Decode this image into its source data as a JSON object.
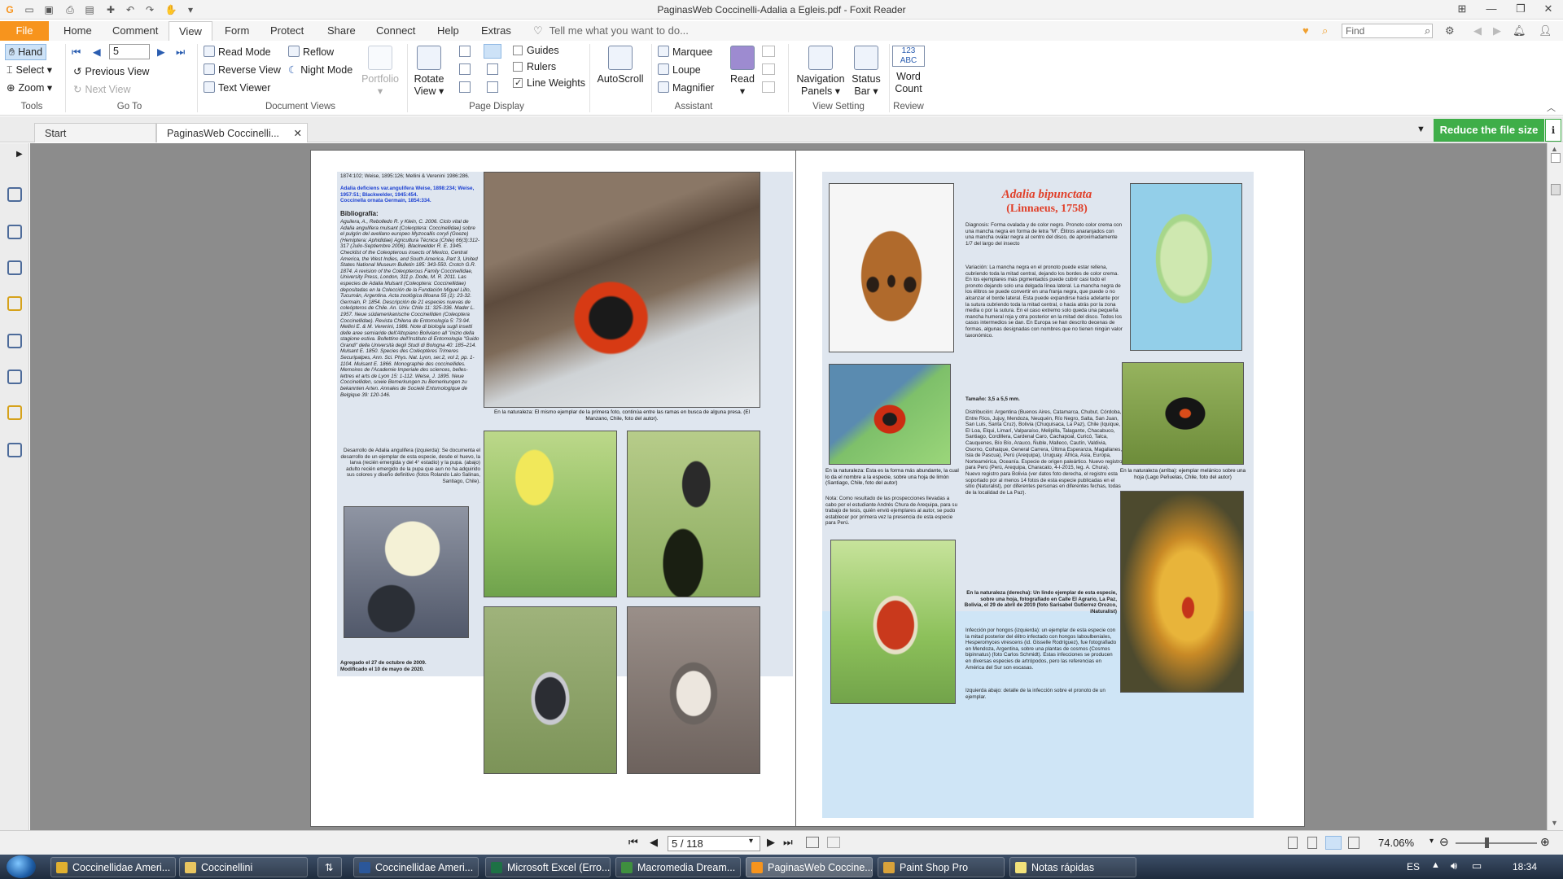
{
  "window": {
    "title": "PaginasWeb Coccinelli-Adalia a Egleis.pdf - Foxit Reader"
  },
  "ribbon_tabs": [
    "File",
    "Home",
    "Comment",
    "View",
    "Form",
    "Protect",
    "Share",
    "Connect",
    "Help",
    "Extras"
  ],
  "tell_me": "Tell me what you want to do...",
  "find_placeholder": "Find",
  "ribbon": {
    "tools": {
      "hand": "Hand",
      "select": "Select",
      "zoom": "Zoom",
      "label": "Tools"
    },
    "goto": {
      "page_value": "5",
      "previous_view": "Previous View",
      "next_view": "Next View",
      "label": "Go To"
    },
    "document_views": {
      "read_mode": "Read Mode",
      "reverse_view": "Reverse View",
      "text_viewer": "Text Viewer",
      "reflow": "Reflow",
      "night_mode": "Night Mode",
      "portfolio": "Portfolio",
      "label": "Document Views"
    },
    "page_display": {
      "rotate_view": "Rotate",
      "rotate_view2": "View",
      "guides": "Guides",
      "rulers": "Rulers",
      "line_weights": "Line Weights",
      "label": "Page Display"
    },
    "autoscroll": "AutoScroll",
    "assistant": {
      "marquee": "Marquee",
      "loupe": "Loupe",
      "magnifier": "Magnifier",
      "read": "Read",
      "label": "Assistant"
    },
    "view_setting": {
      "navigation_panels": "Navigation",
      "navigation_panels2": "Panels",
      "status_bar": "Status",
      "status_bar2": "Bar",
      "label": "View Setting"
    },
    "review": {
      "word_count_icon": "123 ABC",
      "word_count": "Word",
      "word_count2": "Count",
      "label": "Review"
    }
  },
  "doc_tabs": {
    "start": "Start",
    "active": "PaginasWeb Coccinelli..."
  },
  "reduce_button": "Reduce the file size",
  "left_page": {
    "syn_top": "1874:102; Weise, 1895:126; Mellini & Verenini 1986:286.",
    "syn1": "Adalia deficiens var.angulifera Weise, 1898:234; Weise, 1957:51; Blackwelder, 1945:454.",
    "syn2": "Coccinella ornata Germain, 1854:334.",
    "biblio_title": "Bibliografía:",
    "biblio_text": "Aguilera, A., Rebolledo R. y Klein, C. 2006. Ciclo vital de Adalia angulifera mulsant (Coleoptera: Coccinellidae) sobre el pulgón del avellano europeo Myzocallis coryli (Goeze) (Hemiptera: Aphididae) Agricultura Técnica (Chile) 66(3):312-317 (Julio-Septiembre 2006). Blackwelder R. E. 1945. Checklist of the Coleopterous insects of Mexico, Central America, the West Indies, and South America, Part 3, United States National Museum Bulletin 185: 343-550. Crotch G.R. 1874. A revision of the Coleopterous Family Coccinellidae, University Press, London, 311 p. Dode, M. R. 2011. Las especies de Adalia Mulsant (Coleoptera: Coccinellidae) depositadas en la Colección de la Fundación Miguel Lillo, Tucumán, Argentina. Acta zoológica lilloana 55 (1): 23-32. Germain, P. 1854. Descripción de 21 especies nuevas de coleópteros de Chile. An. Univ. Chile 11: 325-336. Mader L. 1957. Neue südamerikanische Coccinelliden (Coleoptera Coccinellidae). Revista Chilena de Entomología 5: 73-94. Mellini E. & M. Verenini, 1986. Note di biologia sugli insetti delle aree semiaride dell'Altopiano Boliviano all \"inizio della stagione estiva. Bollettino dell'Instituto di Entomologia \"Guido Grandi\" della Università degli Studi di Bologna 40: 185–214. Mulsant E. 1850. Species des Coléoptères Trimeres Securipalpes, Ann. Sci. Phys. Nat. Lyon, ser.2, vol 2, pp. 1-1104. Mulsant E. 1866. Monographie des coccinellides. Memoires de l'Academie Imperiale des sciences, belles-lettres et arts de Lyon 15: 1-112. Weise, J. 1895. Neue Coccinelliden, sowie Bemerkungen zu Bemerkungen zu bekannten Arten. Annales de Societé Entomologique de Belgique 39: 120-146.",
    "development": "Desarrollo de Adalia angulifera (izquierda): Se documenta el desarrollo de un ejemplar de esta especie, desde el huevo, la larva (recién emergida y del 4° estadio) y la pupa. (abajo) adulto recién emergido de la pupa que aun no ha adquirido sus colores y diseño definitivo (fotos Rolando Lalo Salinas, Santiago, Chile).",
    "main_caption": "En la naturaleza: El mismo ejemplar de la primera foto, continúa entre las ramas en busca de alguna presa. (El Manzano, Chile, foto del autor).",
    "added": "Agregado el 27 de octubre de 2009.",
    "modified": "Modificado el 10 de mayo de 2020."
  },
  "right_page": {
    "species": "Adalia bipunctata",
    "author": "(Linnaeus, 1758)",
    "diagnosis": "Diagnosis: Forma ovalada y de color negro. Pronoto color crema con una mancha negra en forma de letra \"M\". Élitros anaranjados con una mancha ovalar negra al centro del disco, de aproximadamente 1/7 del largo del insecto",
    "variation": "Variación: La mancha negra en el pronoto puede estar rellena, cubriendo toda la mitad central, dejando los bordes de color crema. En los ejemplares más pigmentados puede cubrir casi todo el pronoto dejando solo una delgada línea lateral. La mancha negra de los élitros se puede convertir en una franja negra, que puede o no alcanzar el borde lateral. Esta puede expandirse hacia adelante por la sutura cubriendo toda la mitad central, o hacia atrás por la zona media o por la sutura. En el caso extremo solo queda una pequeña mancha humeral roja y otra posterior en la mitad del disco. Todos los casos intermedios se dan. En Europa se han descrito decenas de formas, algunas designadas con nombres que no tienen ningún valor taxonómico.",
    "size": "Tamaño: 3,5 a 5,5 mm.",
    "distribution": "Distribución: Argentina (Buenos Aires, Catamarca, Chubut, Córdoba, Entre Ríos, Jujuy, Mendoza, Neuquén, Río Negro, Salta, San Juan, San Luis, Santa Cruz), Bolivia (Chuquisaca, La Paz), Chile (Iquique, El Loa, Elqui, Limarí, Valparaíso, Melipilla, Talagante, Chacabuco, Santiago, Cordillera, Cardenal Caro, Cachapoal, Curicó, Talca, Cauquenes, Bío Bío, Arauco, Ñuble, Malleco, Cautín, Valdivia, Osorno, Coihaique, General Carrera, Última Esperanza, Magallanes, Isla de Pascua), Perú (Arequipa), Uruguay. África, Asia, Europa, Norteamérica, Oceanía. Especie de origen paleártico. Nuevo registro para Perú (Perú, Arequipa, Characato, 4-I-2015, leg. A. Chura). Nuevo registro para Bolivia (ver datos foto derecha, el registro esta soportado por al menos 14 fotos de esta especie publicadas en el sitio (Naturalist), por diferentes personas en diferentes fechas, todas de la localidad de La Paz).",
    "photo2_caption": "En la naturaleza: Esta es la forma más abundante, la cual lo da el nombre a la especie, sobre una hoja de limón (Santiago, Chile, foto del autor)",
    "note": "Nota: Como resultado de las prospecciones llevadas a cabo por el estudiante Andrés Chura de Arequipa, para su trabajo de tesis, quién envió ejemplares al autor, se pudo establecer por primera vez la presencia de esta especie para Perú.",
    "photo_right_caption": "En la naturaleza (arriba): ejemplar melánico sobre una hoja (Lago Peñuelas, Chile, foto del autor)",
    "bolivia_caption": "En la naturaleza (derecha): Un lindo ejemplar de esta especie, sobre una hoja, fotografiado en Calle El Agrario, La Paz, Bolivia, el 29 de abril de 2019 (foto Sarisabel Gutierrez Orozco, iNaturalist)",
    "infection": "Infección por hongos (izquierda): un ejemplar de esta especie con la mitad posterior del élitro infectado con hongos laboulbeniales, Hesperomyces virescens (id. Gisselle Rodríguez), fue fotografiado en Mendoza, Argentina, sobre una plantas de cosmos (Cosmos bipinnatus) (foto Carlos Schmidt). Estas infecciones se producen en diversas especies de artrópodos, pero las referencias en América del Sur son escasas.",
    "infection2": "Izquierda abajo: detalle de la infección sobre el pronoto de un ejemplar."
  },
  "status": {
    "page_value": "5 / 118",
    "zoom": "74.06%"
  },
  "taskbar": {
    "items": [
      "Coccinellidae Ameri...",
      "Coccinellini",
      "Coccinellidae Ameri...",
      "Microsoft Excel (Erro...",
      "Macromedia Dream...",
      "PaginasWeb Coccine...",
      "Paint Shop Pro",
      "Notas rápidas"
    ],
    "lang": "ES",
    "time": "18:34"
  },
  "colors": {
    "file_tab": "#f7941d",
    "reduce": "#3fae49",
    "panel": "#dfe6ef",
    "workspace": "#8c8c8c",
    "species_title": "#e0402a",
    "blue_link": "#1a3fd1"
  }
}
